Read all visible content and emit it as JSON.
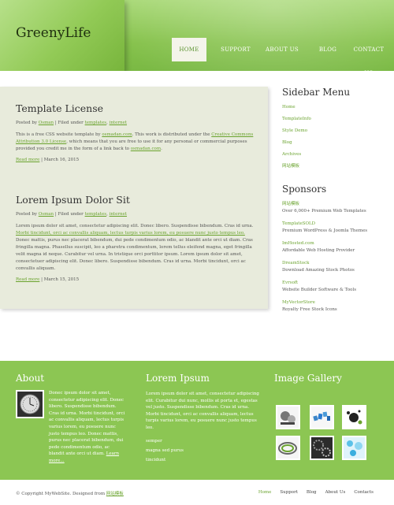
{
  "site": {
    "logo": "GreenyLife"
  },
  "nav": [
    {
      "label": "HOME",
      "active": true
    },
    {
      "label": "SUPPORT",
      "active": false
    },
    {
      "label": "ABOUT US",
      "active": false
    },
    {
      "label": "BLOG",
      "active": false
    },
    {
      "label": "CONTACT US",
      "active": false
    }
  ],
  "posts": [
    {
      "title": "Template License",
      "meta_prefix": "Posted by",
      "author": "Osman",
      "meta_mid": "| Filed under",
      "tags": [
        "templates",
        "internet"
      ],
      "body_start": "This is a free CSS website template by",
      "body_link1": "osmadan.com",
      "body_mid": ". This work is distributed under the",
      "body_link2": "Creative Commons Attribution 3.0 License",
      "body_end": ", which means that you are free to use it for any personal or commercial purposes provided you credit me in the form of a link back to",
      "body_link3": "osmadan.com",
      "body_tail": ".",
      "read_more": "Read more",
      "date": "| March 16, 2015"
    },
    {
      "title": "Lorem Ipsum Dolor Sit",
      "meta_prefix": "Posted by",
      "author": "Osman",
      "meta_mid": "| Filed under",
      "tags": [
        "templates",
        "internet"
      ],
      "body_a": "Lorem ipsum dolor sit amet, consectetur adipiscing elit. Donec libero. Suspendisse bibendum. Cras id urna.",
      "body_link": "Morbi tincidunt, orci ac convallis aliquam, lectus turpis varius lorem, eu posuere nunc justo tempus leo.",
      "body_b": "Donec mattis, purus nec placerat bibendum, dui pede condimentum odio, ac blandit ante orci ut diam. Cras fringilla magna. Phasellus suscipit, leo a pharetra condimentum, lorem tellus eleifend magna, eget fringilla velit magna id neque. Curabitur vel urna. In tristique orci porttitor ipsum. Lorem ipsum dolor sit amet, consectetuer adipiscing elit. Donec libero. Suspendisse bibendum. Cras id urna. Morbi tincidunt, orci ac convallis aliquam.",
      "read_more": "Read more",
      "date": "| March 15, 2015"
    }
  ],
  "sidebar": {
    "menu_title": "Sidebar Menu",
    "menu": [
      "Home",
      "TemplateInfo",
      "Style Demo",
      "Blog",
      "Archives",
      "网站模板"
    ],
    "sponsors_title": "Sponsors",
    "sponsors": [
      {
        "title": "网站模板",
        "desc": "Over 6,000+ Premium Web Templates"
      },
      {
        "title": "TemplateSOLD",
        "desc": "Premium WordPress & Joomla Themes"
      },
      {
        "title": "ImHosted.com",
        "desc": "Affordable Web Hosting Provider"
      },
      {
        "title": "DreamStock",
        "desc": "Download Amazing Stock Photos"
      },
      {
        "title": "Evrsoft",
        "desc": "Website Builder Software & Tools"
      },
      {
        "title": "MyVectorStore",
        "desc": "Royalty Free Stock Icons"
      }
    ]
  },
  "footer": {
    "about_title": "About",
    "about_text": "Donec ipsum dolor sit amet, consectetur adipiscing elit. Donec libero. Suspendisse bibendum. Cras id urna. Morbi tincidunt, orci ac convallis aliquam, lectus turpis varius lorem, eu posuere nunc justo tempus leo. Donec mattis, purus nec placerat bibendum, dui pede condimentum odio, ac blandit ante orci ut diam.",
    "about_link": "Learn more...",
    "lorem_title": "Lorem Ipsum",
    "lorem_text": "Lorem ipsum dolor sit amet, consectetur adipiscing elit. Curabitur dui nunc, mollis at porta et, egestas vel justo. Suspendisse bibendum. Cras id urna. Morbi tincidunt, orci ac convallis aliquam, lectus turpis varius lorem, eu posuere nunc justo tempus leo.",
    "lorem_links": [
      "semper",
      "magna sed purus",
      "tincidunt"
    ],
    "gallery_title": "Image Gallery"
  },
  "bottom": {
    "copyright": "© Copyright MyWebSite. Designed from",
    "copyright_link": "网站模板",
    "nav": [
      "Home",
      "Support",
      "Blog",
      "About Us",
      "Contacts"
    ]
  },
  "colors": {
    "accent": "#6aa32e",
    "footer_bg": "#8cc653",
    "content_bg": "#e8ebdc"
  }
}
